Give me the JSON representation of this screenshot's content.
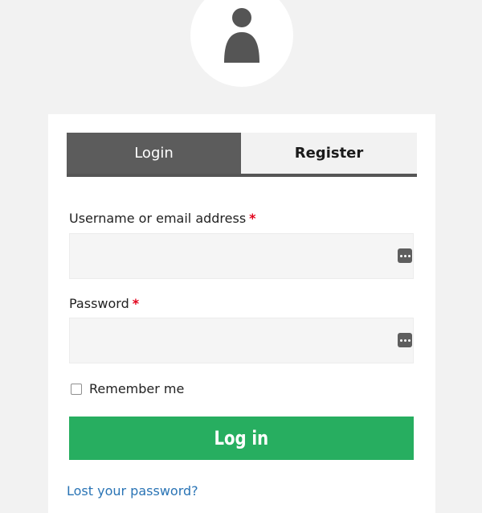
{
  "header": {
    "avatar_icon": "user-icon"
  },
  "tabs": [
    {
      "label": "Login",
      "active": true
    },
    {
      "label": "Register",
      "active": false
    }
  ],
  "form": {
    "username": {
      "label": "Username or email address",
      "required_marker": "*",
      "value": "",
      "placeholder": "",
      "icon": "password-manager-icon"
    },
    "password": {
      "label": "Password",
      "required_marker": "*",
      "value": "",
      "placeholder": "",
      "icon": "password-manager-icon"
    },
    "remember": {
      "label": "Remember me",
      "checked": false
    },
    "submit_label": "Log in",
    "lost_password_label": "Lost your password?"
  },
  "colors": {
    "page_background": "#f2f2f2",
    "active_tab": "#5c5c5c",
    "submit_button": "#27ae60",
    "required": "#e2001a",
    "link": "#2a74b5"
  }
}
